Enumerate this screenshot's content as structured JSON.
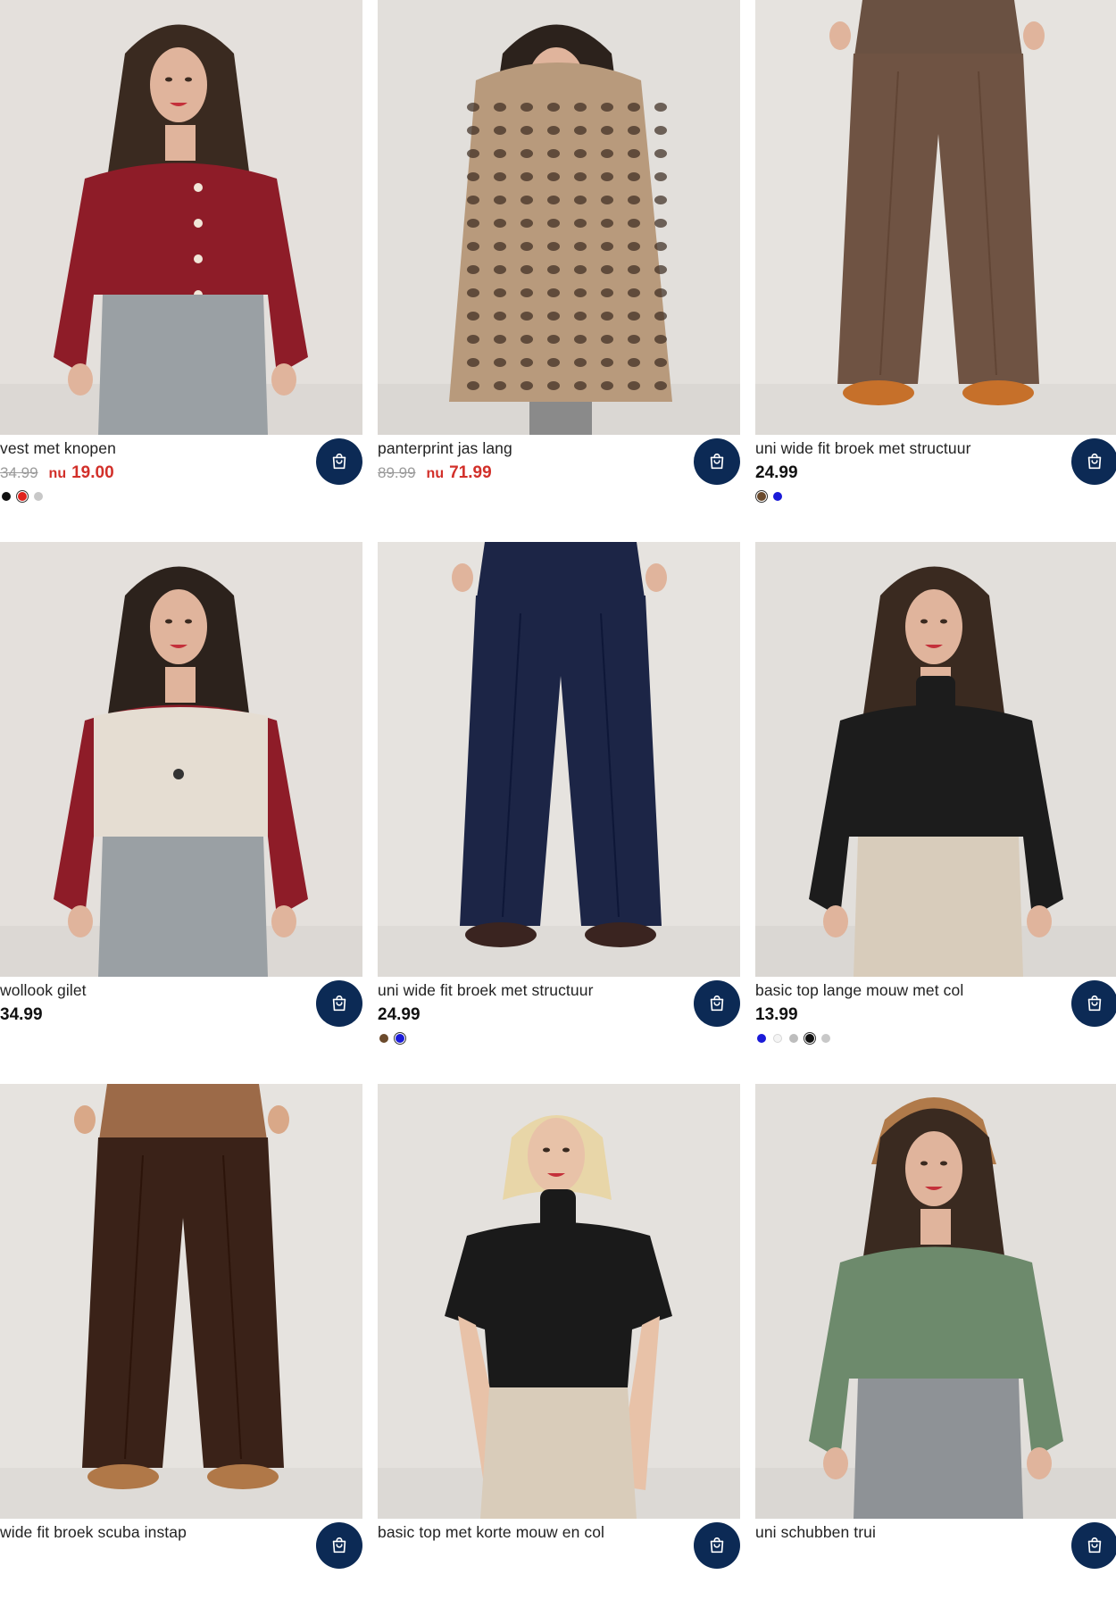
{
  "products": [
    {
      "title": "vest met knopen",
      "old_price": "34.99",
      "now_label": "nu",
      "price": "19.00",
      "image": {
        "bg": "#e4e0dc",
        "top": "#8e1c28",
        "bottom": "#9aa0a4",
        "skin": "#e0b49c",
        "hair": "#3a2a20",
        "type": "cardigan"
      },
      "swatches": [
        {
          "color": "#111111",
          "selected": false
        },
        {
          "color": "#e0221c",
          "selected": true
        },
        {
          "color": "#c8c8c8",
          "selected": false
        }
      ]
    },
    {
      "title": "panterprint jas lang",
      "old_price": "89.99",
      "now_label": "nu",
      "price": "71.99",
      "image": {
        "bg": "#e2dfdb",
        "top": "#b89a7c",
        "bottom": "#8a8a8a",
        "skin": "#e0b49c",
        "hair": "#2c221c",
        "type": "coat"
      },
      "swatches": []
    },
    {
      "title": "uni wide fit broek met structuur",
      "price": "24.99",
      "image": {
        "bg": "#e6e3df",
        "top": "#6a5142",
        "bottom": "#6f5343",
        "skin": "#e0b49c",
        "hair": "#2c221c",
        "type": "trousers",
        "shoes": "#c6702a"
      },
      "swatches": [
        {
          "color": "#6b4a2c",
          "selected": true
        },
        {
          "color": "#1a1ad8",
          "selected": false
        }
      ]
    },
    {
      "title": "wollook gilet",
      "price": "34.99",
      "image": {
        "bg": "#e4e0dc",
        "top": "#e5ddd2",
        "bottom": "#9aa0a4",
        "skin": "#e0b49c",
        "hair": "#2c221c",
        "type": "gilet",
        "sleeves": "#8e1c28"
      },
      "swatches": []
    },
    {
      "title": "uni wide fit broek met structuur",
      "price": "24.99",
      "image": {
        "bg": "#e6e3df",
        "top": "#1c2546",
        "bottom": "#1c2546",
        "skin": "#e0b49c",
        "hair": "#2c221c",
        "type": "trousers",
        "shoes": "#3a2420"
      },
      "swatches": [
        {
          "color": "#6b4a2c",
          "selected": false
        },
        {
          "color": "#1a1ad8",
          "selected": true
        }
      ]
    },
    {
      "title": "basic top lange mouw met col",
      "price": "13.99",
      "image": {
        "bg": "#e2dfdb",
        "top": "#1c1c1c",
        "bottom": "#d8ccbb",
        "skin": "#e0b49c",
        "hair": "#3a2a20",
        "type": "turtleneck"
      },
      "swatches": [
        {
          "color": "#1a1ad8",
          "selected": false
        },
        {
          "color": "#f4f4f4",
          "selected": false
        },
        {
          "color": "#bdbdbd",
          "selected": false
        },
        {
          "color": "#111111",
          "selected": true
        },
        {
          "color": "#c8c8c8",
          "selected": false
        }
      ]
    },
    {
      "title": "wide fit broek scuba instap",
      "price": "",
      "image": {
        "bg": "#e6e3df",
        "top": "#9c6a48",
        "bottom": "#3a2218",
        "skin": "#d9a888",
        "hair": "#2c221c",
        "type": "trousers",
        "shoes": "#b07848"
      },
      "swatches": []
    },
    {
      "title": "basic top met korte mouw en col",
      "price": "",
      "image": {
        "bg": "#e4e1dd",
        "top": "#1a1a1a",
        "bottom": "#d9ccba",
        "skin": "#e8c2a8",
        "hair": "#e8d6a8",
        "type": "tee"
      },
      "swatches": []
    },
    {
      "title": "uni schubben trui",
      "price": "",
      "image": {
        "bg": "#e2dfdb",
        "top": "#6d8a6c",
        "bottom": "#8e9296",
        "skin": "#e0b49c",
        "hair": "#3a2a20",
        "type": "sweater",
        "hat": "#b07a4a"
      },
      "swatches": []
    }
  ],
  "cart_button_label": "in winkelmand"
}
